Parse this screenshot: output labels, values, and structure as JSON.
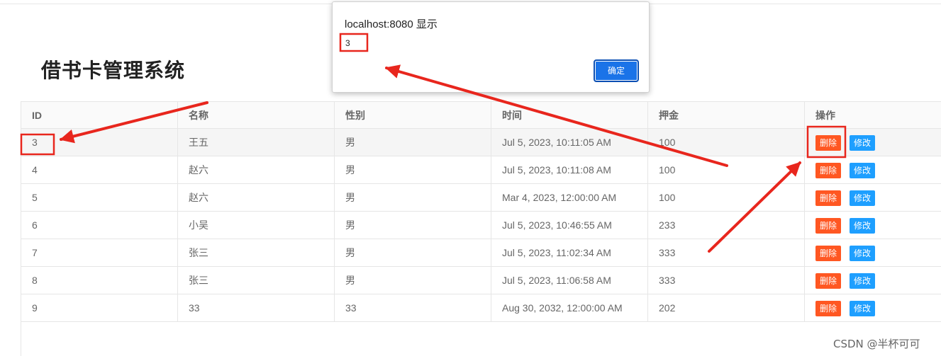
{
  "page": {
    "title": "借书卡管理系统"
  },
  "table": {
    "headers": [
      "ID",
      "名称",
      "性别",
      "时间",
      "押金",
      "操作"
    ],
    "delete_label": "删除",
    "edit_label": "修改",
    "rows": [
      [
        "3",
        "王五",
        "男",
        "Jul 5, 2023, 10:11:05 AM",
        "100"
      ],
      [
        "4",
        "赵六",
        "男",
        "Jul 5, 2023, 10:11:08 AM",
        "100"
      ],
      [
        "5",
        "赵六",
        "男",
        "Mar 4, 2023, 12:00:00 AM",
        "100"
      ],
      [
        "6",
        "小吴",
        "男",
        "Jul 5, 2023, 10:46:55 AM",
        "233"
      ],
      [
        "7",
        "张三",
        "男",
        "Jul 5, 2023, 11:02:34 AM",
        "333"
      ],
      [
        "8",
        "张三",
        "男",
        "Jul 5, 2023, 11:06:58 AM",
        "333"
      ],
      [
        "9",
        "33",
        "33",
        "Aug 30, 2032, 12:00:00 AM",
        "202"
      ]
    ]
  },
  "dialog": {
    "title": "localhost:8080 显示",
    "message": "3",
    "ok_label": "确定"
  },
  "watermark": "CSDN @半杯可可",
  "annotation_color": "#e8261d"
}
